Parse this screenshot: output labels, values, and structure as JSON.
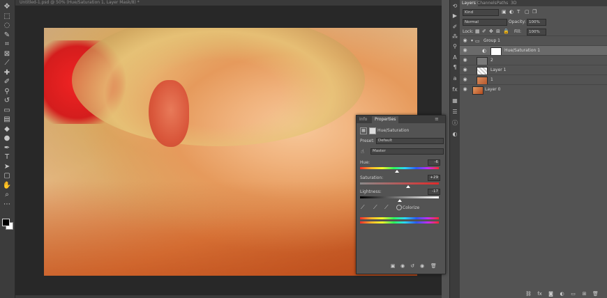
{
  "document": {
    "title": "Untitled-1.psd @ 50% (Hue/Saturation 1, Layer Mask/8) *"
  },
  "colors": {
    "panel_bg": "#535353",
    "dark_bg": "#282828",
    "accent_red": "#d41d1d"
  },
  "toolbar": {
    "tools": [
      {
        "name": "move-tool-icon",
        "glyph": "✥"
      },
      {
        "name": "marquee-tool-icon",
        "glyph": "⬚"
      },
      {
        "name": "lasso-tool-icon",
        "glyph": "◌"
      },
      {
        "name": "quick-select-tool-icon",
        "glyph": "✎"
      },
      {
        "name": "crop-tool-icon",
        "glyph": "⌗"
      },
      {
        "name": "frame-tool-icon",
        "glyph": "⊠"
      },
      {
        "name": "eyedropper-tool-icon",
        "glyph": "⟋"
      },
      {
        "name": "healing-brush-tool-icon",
        "glyph": "✚"
      },
      {
        "name": "brush-tool-icon",
        "glyph": "✐"
      },
      {
        "name": "clone-stamp-tool-icon",
        "glyph": "⚲"
      },
      {
        "name": "history-brush-tool-icon",
        "glyph": "↺"
      },
      {
        "name": "eraser-tool-icon",
        "glyph": "▭"
      },
      {
        "name": "gradient-tool-icon",
        "glyph": "▤"
      },
      {
        "name": "blur-tool-icon",
        "glyph": "◆"
      },
      {
        "name": "dodge-tool-icon",
        "glyph": "●"
      },
      {
        "name": "pen-tool-icon",
        "glyph": "✒"
      },
      {
        "name": "type-tool-icon",
        "glyph": "T"
      },
      {
        "name": "path-select-tool-icon",
        "glyph": "➤"
      },
      {
        "name": "shape-tool-icon",
        "glyph": "▢"
      },
      {
        "name": "hand-tool-icon",
        "glyph": "✋"
      },
      {
        "name": "zoom-tool-icon",
        "glyph": "⌕"
      },
      {
        "name": "more-tools-icon",
        "glyph": "⋯"
      }
    ]
  },
  "properties_panel": {
    "tabs": [
      "Info",
      "Properties"
    ],
    "header": "Hue/Saturation",
    "preset_label": "Preset:",
    "preset_value": "Default",
    "channel_value": "Master",
    "hue": {
      "label": "Hue:",
      "value": "-6",
      "level": 0.47
    },
    "saturation": {
      "label": "Saturation:",
      "value": "+29",
      "level": 0.61
    },
    "lightness": {
      "label": "Lightness:",
      "value": "-17",
      "level": 0.5
    },
    "colorize_label": "Colorize"
  },
  "layers_panel": {
    "tabs": [
      "Layers",
      "Channels",
      "Paths",
      "3D"
    ],
    "kind_label": "Kind",
    "blend_mode": "Normal",
    "opacity_label": "Opacity:",
    "opacity_value": "100%",
    "lock_label": "Lock:",
    "fill_label": "Fill:",
    "fill_value": "100%",
    "layers": [
      {
        "name": "Group 1",
        "type": "group",
        "selected": false
      },
      {
        "name": "Hue/Saturation 1",
        "type": "adjustment",
        "selected": true
      },
      {
        "name": "2",
        "type": "layer",
        "selected": false
      },
      {
        "name": "Layer 1",
        "type": "layer",
        "selected": false
      },
      {
        "name": "1",
        "type": "layer",
        "selected": false
      },
      {
        "name": "Layer 0",
        "type": "layer",
        "selected": false
      }
    ]
  },
  "status": {
    "zoom": "50%"
  }
}
